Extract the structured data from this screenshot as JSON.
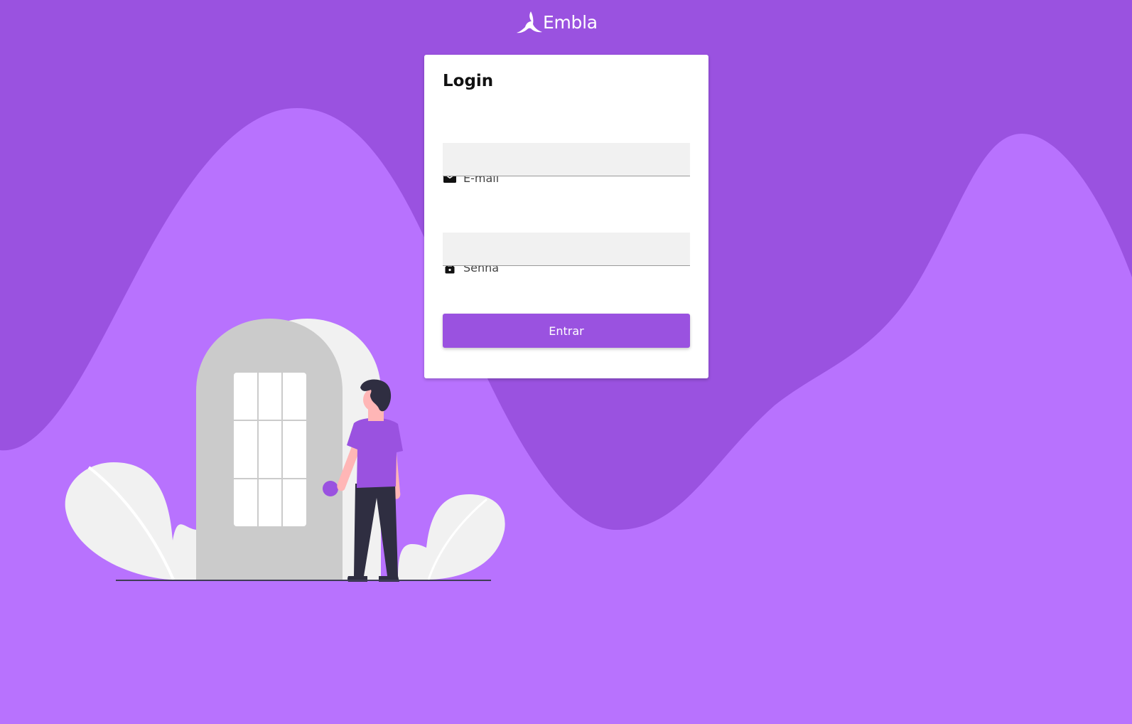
{
  "brand": {
    "name": "Embla",
    "logo_icon": "embla-leaf-icon"
  },
  "colors": {
    "background_dark": "#9a52e0",
    "background_light": "#b872fe",
    "accent": "#9a52e0",
    "card": "#ffffff",
    "input_bg": "#f1f1f1"
  },
  "login_form": {
    "title": "Login",
    "email": {
      "label": "E-mail",
      "icon": "envelope-icon",
      "value": "",
      "placeholder": ""
    },
    "password": {
      "label": "Senha",
      "icon": "lock-icon",
      "value": "",
      "placeholder": ""
    },
    "submit_label": "Entrar"
  },
  "illustration": {
    "name": "person-at-door-illustration"
  }
}
